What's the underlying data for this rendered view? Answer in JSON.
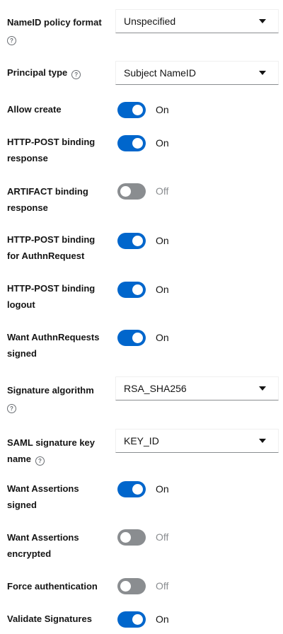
{
  "fields": {
    "nameid_policy": {
      "label": "NameID policy format",
      "value": "Unspecified"
    },
    "principal_type": {
      "label": "Principal type",
      "value": "Subject NameID"
    },
    "allow_create": {
      "label": "Allow create",
      "state": "On"
    },
    "http_post_response": {
      "label_line1": "HTTP-POST binding",
      "label_line2": "response",
      "state": "On"
    },
    "artifact_response": {
      "label_line1": "ARTIFACT binding",
      "label_line2": "response",
      "state": "Off"
    },
    "http_post_authn": {
      "label_line1": "HTTP-POST binding",
      "label_line2": "for AuthnRequest",
      "state": "On"
    },
    "http_post_logout": {
      "label_line1": "HTTP-POST binding",
      "label_line2": "logout",
      "state": "On"
    },
    "want_authn_signed": {
      "label_line1": "Want AuthnRequests",
      "label_line2": "signed",
      "state": "On"
    },
    "signature_algorithm": {
      "label": "Signature algorithm",
      "value": "RSA_SHA256"
    },
    "saml_key_name": {
      "label_line1": "SAML signature key",
      "label_line2": "name",
      "value": "KEY_ID"
    },
    "want_assertions_signed": {
      "label_line1": "Want Assertions",
      "label_line2": "signed",
      "state": "On"
    },
    "want_assertions_encrypted": {
      "label_line1": "Want Assertions",
      "label_line2": "encrypted",
      "state": "Off"
    },
    "force_authentication": {
      "label": "Force authentication",
      "state": "Off"
    },
    "validate_signatures": {
      "label": "Validate Signatures",
      "state": "On"
    }
  },
  "icons": {
    "help": "?"
  },
  "colors": {
    "switch_on": "#0066cc",
    "switch_off": "#8a8d90",
    "text": "#151515",
    "muted": "#8a8d90"
  }
}
